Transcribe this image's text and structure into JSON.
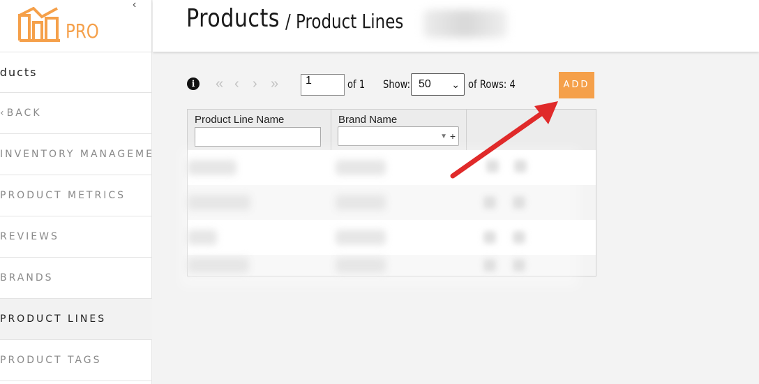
{
  "brand": {
    "logo_text": "PRO",
    "accent": "#f5a04a"
  },
  "sidebar": {
    "header": "oducts",
    "items": [
      {
        "label": "BACK",
        "has_chevron": true
      },
      {
        "label": "INVENTORY MANAGEMENT"
      },
      {
        "label": "PRODUCT METRICS"
      },
      {
        "label": "REVIEWS"
      },
      {
        "label": "BRANDS"
      },
      {
        "label": "PRODUCT LINES",
        "active": true
      },
      {
        "label": "PRODUCT TAGS"
      }
    ]
  },
  "header": {
    "title": "Products",
    "subtitle": "/ Product Lines"
  },
  "toolbar": {
    "page_value": "1",
    "of_pages": "of 1",
    "show_label": "Show:",
    "show_value": "50",
    "rows_label": "of Rows: 4",
    "add_label": "ADD"
  },
  "table": {
    "columns": [
      "Product Line Name",
      "Brand Name"
    ],
    "row_count": 4
  },
  "icons": {
    "collapse": "chevron-left-icon",
    "info": "info-icon",
    "first": "double-chevron-left-icon",
    "prev": "chevron-left-icon",
    "next": "chevron-right-icon",
    "last": "double-chevron-right-icon"
  }
}
